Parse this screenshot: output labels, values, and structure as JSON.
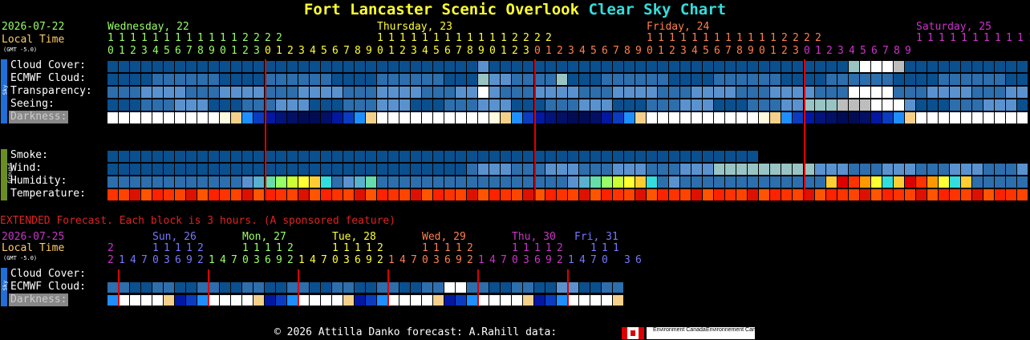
{
  "title": {
    "part1": "Fort Lancaster Scenic Overlook",
    "part2": "Clear Sky Chart"
  },
  "colors": {
    "cloud_dark": "#0a4f8e",
    "cloud_mid": "#2d6ead",
    "cloud_light": "#5a92cf",
    "cloud_pale": "#98c4c4",
    "white": "#ffffff",
    "grey": "#bdbdbd",
    "red_line": "#dd0000",
    "green": "#99ff66",
    "yellow": "#ffff33",
    "orange": "#ff7f4f",
    "magenta": "#cc33cc"
  },
  "header": {
    "date": "2026-07-22",
    "local_time": "Local Time",
    "gmt": "(GMT -5.0)",
    "days": [
      "Wednesday, 22",
      "Thursday, 23",
      "Friday, 24",
      "Saturday, 25"
    ],
    "hours_tens": "1111111111112222",
    "hours_ones": "012345678901230123456789012345678901230123456789012345678901230123456789"
  },
  "sky_rows": {
    "side_label": "Sky",
    "labels": [
      "Cloud Cover:",
      "ECMWF Cloud:",
      "Transparency:",
      "Seeing:",
      "Darkness:"
    ]
  },
  "ground_rows": {
    "side_label": "Ground",
    "labels": [
      "Smoke:",
      "Wind:",
      "Humidity:",
      "Temperature:"
    ]
  },
  "extended": {
    "banner": "EXTENDED Forecast. Each block is 3 hours. (A sponsored feature)",
    "date": "2026-07-25",
    "local_time": "Local Time",
    "gmt": "(GMT -5.0)",
    "days": [
      "Sun, 26",
      "Mon, 27",
      "Tue, 28",
      "Wed, 29",
      "Thu, 30",
      "Fri, 31"
    ],
    "tens_first": "2",
    "tens_block": "11112",
    "tens_last": "111",
    "ones_first": "2",
    "ones_block": "14703692",
    "ones_last": "1470 36",
    "labels": [
      "Cloud Cover:",
      "ECMWF Cloud:",
      "Darkness:"
    ]
  },
  "footer": {
    "text": "© 2026 Attilla Danko  forecast: A.Rahill  data:",
    "env1": "Environment Canada",
    "env2": "Environnement Canada"
  }
}
